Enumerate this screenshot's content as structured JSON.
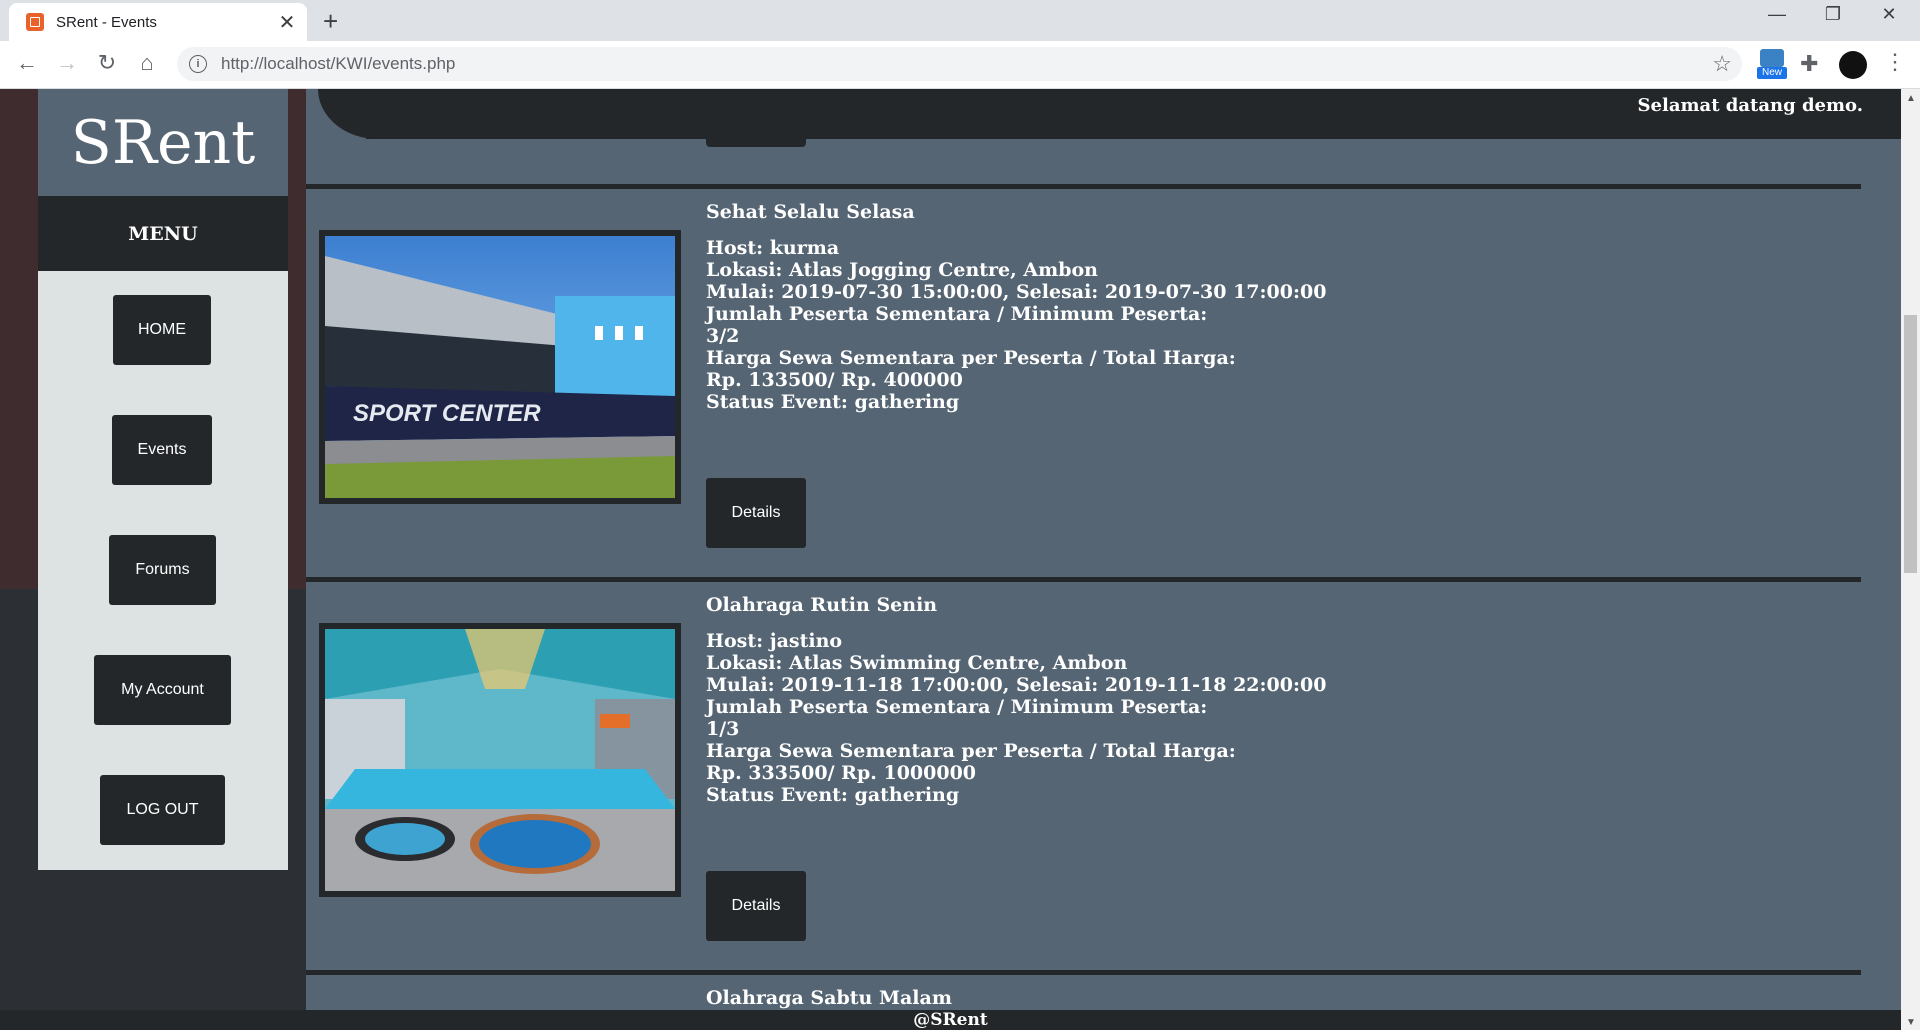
{
  "browser": {
    "tab_title": "SRent - Events",
    "tab_close": "✕",
    "new_tab": "+",
    "url": "http://localhost/KWI/events.php",
    "ext_new_label": "New",
    "window_controls": {
      "minimize": "—",
      "restore": "❐",
      "close": "✕"
    }
  },
  "sidebar": {
    "logo": "SRent",
    "menu_title": "MENU",
    "items": [
      {
        "label": "HOME"
      },
      {
        "label": "Events"
      },
      {
        "label": "Forums"
      },
      {
        "label": "My Account"
      },
      {
        "label": "LOG OUT"
      }
    ]
  },
  "header": {
    "welcome": "Selamat datang demo."
  },
  "events": [
    {
      "title": "Sehat Selalu Selasa",
      "host": "Host: kurma",
      "lokasi": "Lokasi: Atlas Jogging Centre, Ambon",
      "waktu": "Mulai: 2019-07-30 15:00:00, Selesai: 2019-07-30 17:00:00",
      "peserta_label": "Jumlah Peserta Sementara / Minimum Peserta:",
      "peserta_value": "3/2",
      "harga_label": "Harga Sewa Sementara per Peserta / Total Harga:",
      "harga_value": "Rp. 133500/ Rp. 400000",
      "status": "Status Event: gathering",
      "details_label": "Details",
      "image_text": "SPORT CENTER"
    },
    {
      "title": "Olahraga Rutin Senin",
      "host": "Host: jastino",
      "lokasi": "Lokasi: Atlas Swimming Centre, Ambon",
      "waktu": "Mulai: 2019-11-18 17:00:00, Selesai: 2019-11-18 22:00:00",
      "peserta_label": "Jumlah Peserta Sementara / Minimum Peserta:",
      "peserta_value": "1/3",
      "harga_label": "Harga Sewa Sementara per Peserta / Total Harga:",
      "harga_value": "Rp. 333500/ Rp. 1000000",
      "status": "Status Event: gathering",
      "details_label": "Details"
    },
    {
      "title": "Olahraga Sabtu Malam"
    }
  ],
  "footer": {
    "text": "@SRent"
  }
}
